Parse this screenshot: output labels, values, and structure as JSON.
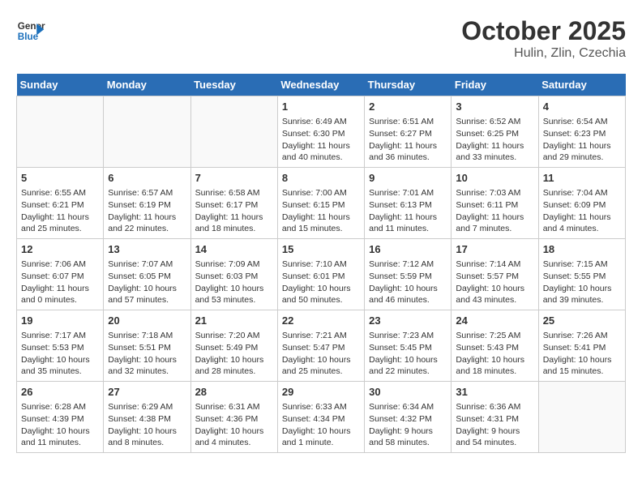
{
  "header": {
    "logo_line1": "General",
    "logo_line2": "Blue",
    "title": "October 2025",
    "subtitle": "Hulin, Zlin, Czechia"
  },
  "days_of_week": [
    "Sunday",
    "Monday",
    "Tuesday",
    "Wednesday",
    "Thursday",
    "Friday",
    "Saturday"
  ],
  "weeks": [
    [
      {
        "num": "",
        "info": "",
        "empty": true
      },
      {
        "num": "",
        "info": "",
        "empty": true
      },
      {
        "num": "",
        "info": "",
        "empty": true
      },
      {
        "num": "1",
        "info": "Sunrise: 6:49 AM\nSunset: 6:30 PM\nDaylight: 11 hours\nand 40 minutes."
      },
      {
        "num": "2",
        "info": "Sunrise: 6:51 AM\nSunset: 6:27 PM\nDaylight: 11 hours\nand 36 minutes."
      },
      {
        "num": "3",
        "info": "Sunrise: 6:52 AM\nSunset: 6:25 PM\nDaylight: 11 hours\nand 33 minutes."
      },
      {
        "num": "4",
        "info": "Sunrise: 6:54 AM\nSunset: 6:23 PM\nDaylight: 11 hours\nand 29 minutes."
      }
    ],
    [
      {
        "num": "5",
        "info": "Sunrise: 6:55 AM\nSunset: 6:21 PM\nDaylight: 11 hours\nand 25 minutes."
      },
      {
        "num": "6",
        "info": "Sunrise: 6:57 AM\nSunset: 6:19 PM\nDaylight: 11 hours\nand 22 minutes."
      },
      {
        "num": "7",
        "info": "Sunrise: 6:58 AM\nSunset: 6:17 PM\nDaylight: 11 hours\nand 18 minutes."
      },
      {
        "num": "8",
        "info": "Sunrise: 7:00 AM\nSunset: 6:15 PM\nDaylight: 11 hours\nand 15 minutes."
      },
      {
        "num": "9",
        "info": "Sunrise: 7:01 AM\nSunset: 6:13 PM\nDaylight: 11 hours\nand 11 minutes."
      },
      {
        "num": "10",
        "info": "Sunrise: 7:03 AM\nSunset: 6:11 PM\nDaylight: 11 hours\nand 7 minutes."
      },
      {
        "num": "11",
        "info": "Sunrise: 7:04 AM\nSunset: 6:09 PM\nDaylight: 11 hours\nand 4 minutes."
      }
    ],
    [
      {
        "num": "12",
        "info": "Sunrise: 7:06 AM\nSunset: 6:07 PM\nDaylight: 11 hours\nand 0 minutes."
      },
      {
        "num": "13",
        "info": "Sunrise: 7:07 AM\nSunset: 6:05 PM\nDaylight: 10 hours\nand 57 minutes."
      },
      {
        "num": "14",
        "info": "Sunrise: 7:09 AM\nSunset: 6:03 PM\nDaylight: 10 hours\nand 53 minutes."
      },
      {
        "num": "15",
        "info": "Sunrise: 7:10 AM\nSunset: 6:01 PM\nDaylight: 10 hours\nand 50 minutes."
      },
      {
        "num": "16",
        "info": "Sunrise: 7:12 AM\nSunset: 5:59 PM\nDaylight: 10 hours\nand 46 minutes."
      },
      {
        "num": "17",
        "info": "Sunrise: 7:14 AM\nSunset: 5:57 PM\nDaylight: 10 hours\nand 43 minutes."
      },
      {
        "num": "18",
        "info": "Sunrise: 7:15 AM\nSunset: 5:55 PM\nDaylight: 10 hours\nand 39 minutes."
      }
    ],
    [
      {
        "num": "19",
        "info": "Sunrise: 7:17 AM\nSunset: 5:53 PM\nDaylight: 10 hours\nand 35 minutes."
      },
      {
        "num": "20",
        "info": "Sunrise: 7:18 AM\nSunset: 5:51 PM\nDaylight: 10 hours\nand 32 minutes."
      },
      {
        "num": "21",
        "info": "Sunrise: 7:20 AM\nSunset: 5:49 PM\nDaylight: 10 hours\nand 28 minutes."
      },
      {
        "num": "22",
        "info": "Sunrise: 7:21 AM\nSunset: 5:47 PM\nDaylight: 10 hours\nand 25 minutes."
      },
      {
        "num": "23",
        "info": "Sunrise: 7:23 AM\nSunset: 5:45 PM\nDaylight: 10 hours\nand 22 minutes."
      },
      {
        "num": "24",
        "info": "Sunrise: 7:25 AM\nSunset: 5:43 PM\nDaylight: 10 hours\nand 18 minutes."
      },
      {
        "num": "25",
        "info": "Sunrise: 7:26 AM\nSunset: 5:41 PM\nDaylight: 10 hours\nand 15 minutes."
      }
    ],
    [
      {
        "num": "26",
        "info": "Sunrise: 6:28 AM\nSunset: 4:39 PM\nDaylight: 10 hours\nand 11 minutes."
      },
      {
        "num": "27",
        "info": "Sunrise: 6:29 AM\nSunset: 4:38 PM\nDaylight: 10 hours\nand 8 minutes."
      },
      {
        "num": "28",
        "info": "Sunrise: 6:31 AM\nSunset: 4:36 PM\nDaylight: 10 hours\nand 4 minutes."
      },
      {
        "num": "29",
        "info": "Sunrise: 6:33 AM\nSunset: 4:34 PM\nDaylight: 10 hours\nand 1 minute."
      },
      {
        "num": "30",
        "info": "Sunrise: 6:34 AM\nSunset: 4:32 PM\nDaylight: 9 hours\nand 58 minutes."
      },
      {
        "num": "31",
        "info": "Sunrise: 6:36 AM\nSunset: 4:31 PM\nDaylight: 9 hours\nand 54 minutes."
      },
      {
        "num": "",
        "info": "",
        "empty": true
      }
    ]
  ]
}
